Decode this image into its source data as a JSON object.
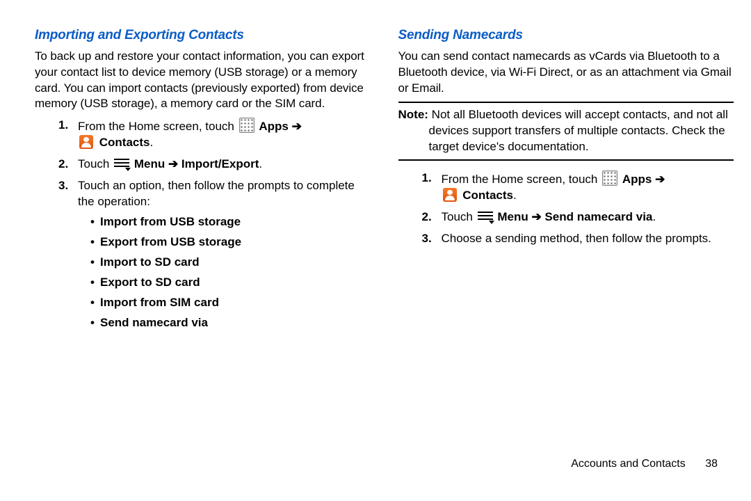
{
  "left": {
    "title": "Importing and Exporting Contacts",
    "intro": "To back up and restore your contact information, you can export your contact list to device memory (USB storage) or a memory card. You can import contacts (previously exported) from device memory (USB storage), a memory card or the SIM card.",
    "step1_pre": "From the Home screen, touch ",
    "apps_label": "Apps",
    "arrow": " ➔",
    "contacts_label": "Contacts",
    "step2_pre": "Touch ",
    "menu_label": "Menu ",
    "step2_post": " Import/Export",
    "step3": "Touch an option, then follow the prompts to complete the operation:",
    "opts": {
      "o1": "Import from USB storage",
      "o2": "Export from USB storage",
      "o3": "Import to SD card",
      "o4": "Export to SD card",
      "o5": "Import from SIM card",
      "o6": "Send namecard via"
    }
  },
  "right": {
    "title": "Sending Namecards",
    "intro": "You can send contact namecards as vCards via Bluetooth to a Bluetooth device, via Wi-Fi Direct, or as an attachment via Gmail or Email.",
    "note_label": "Note:",
    "note_body": " Not all Bluetooth devices will accept contacts, and not all devices support transfers of multiple contacts. Check the target device's documentation.",
    "step1_pre": "From the Home screen, touch ",
    "apps_label": "Apps",
    "arrow": " ➔",
    "contacts_label": "Contacts",
    "step2_pre": "Touch ",
    "menu_label": "Menu ",
    "step2_post": " Send namecard via",
    "step3": "Choose a sending method, then follow the prompts."
  },
  "footer": {
    "section": "Accounts and Contacts",
    "page": "38"
  }
}
